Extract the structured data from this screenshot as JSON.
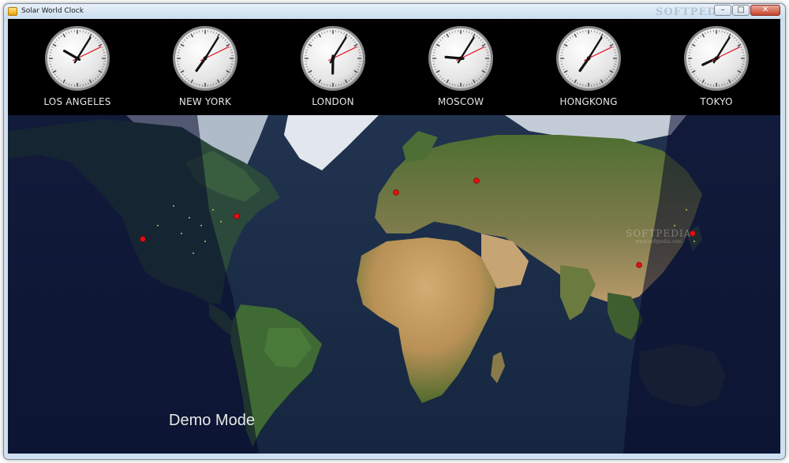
{
  "window": {
    "title": "Solar World Clock",
    "watermark": "SOFTPEDIA"
  },
  "controls": {
    "minimize": "–",
    "maximize": "□",
    "close": "✕"
  },
  "clocks": [
    {
      "city": "LOS ANGELES",
      "hour_angle": 300,
      "minute_angle": 32,
      "second_angle": 64
    },
    {
      "city": "NEW YORK",
      "hour_angle": 215,
      "minute_angle": 32,
      "second_angle": 64
    },
    {
      "city": "LONDON",
      "hour_angle": 181,
      "minute_angle": 32,
      "second_angle": 64
    },
    {
      "city": "MOSCOW",
      "hour_angle": 275,
      "minute_angle": 32,
      "second_angle": 64
    },
    {
      "city": "HONGKONG",
      "hour_angle": 215,
      "minute_angle": 32,
      "second_angle": 64
    },
    {
      "city": "TOKYO",
      "hour_angle": 245,
      "minute_angle": 32,
      "second_angle": 64
    }
  ],
  "map": {
    "demo_label": "Demo Mode",
    "watermark": "SOFTPEDIA",
    "watermark_sub": "www.softpedia.com"
  }
}
